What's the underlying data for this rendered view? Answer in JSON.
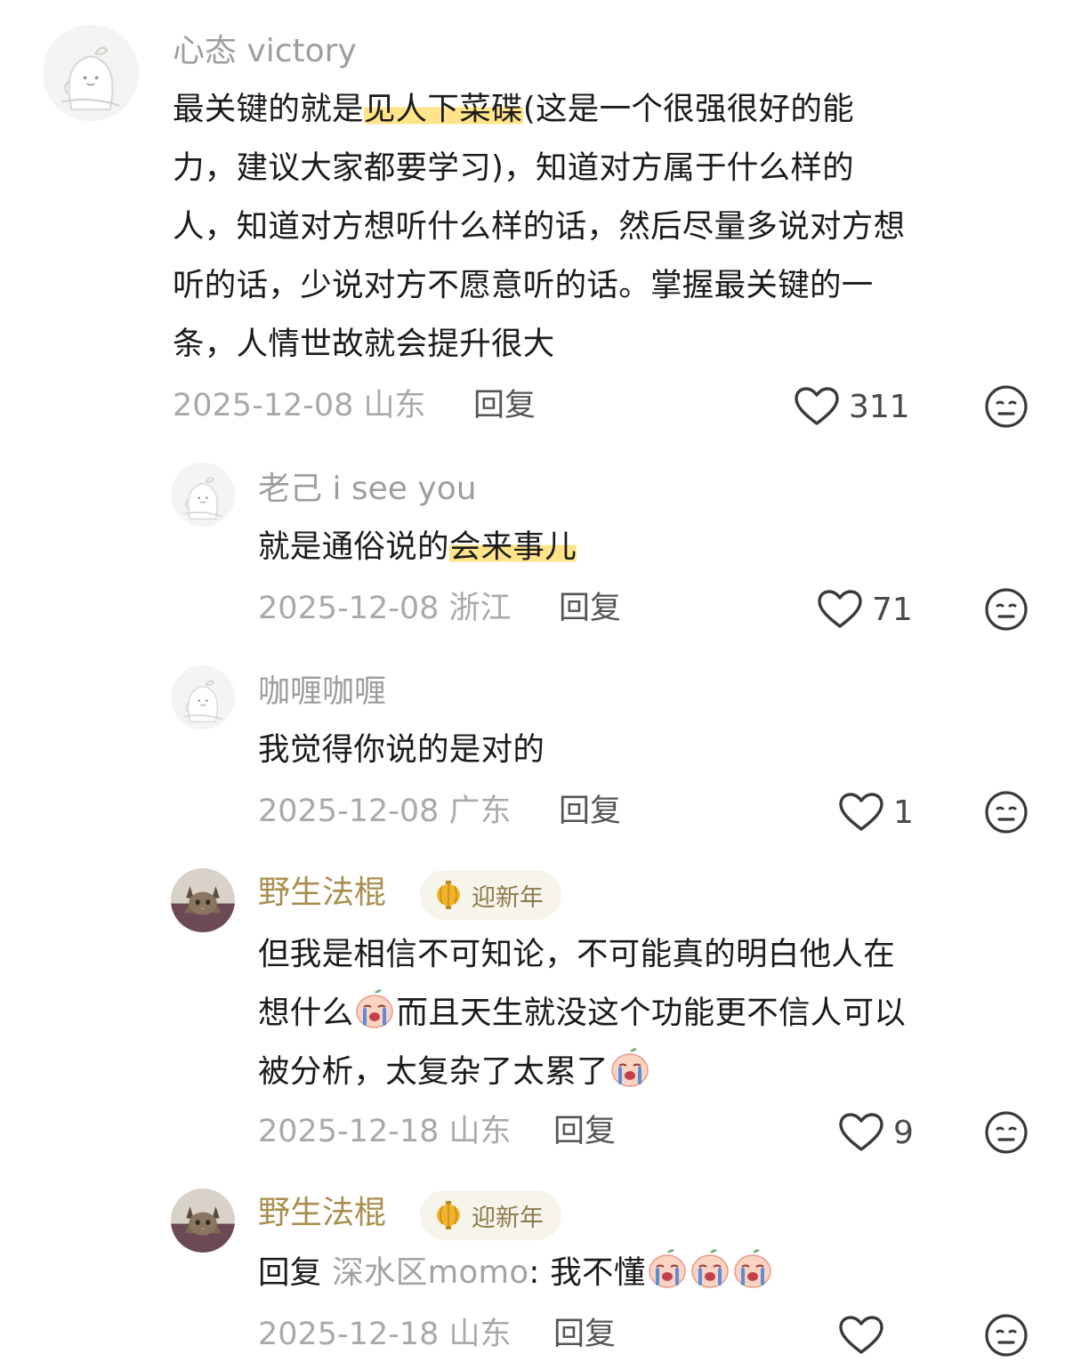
{
  "comments": [
    {
      "username": "心态 victory",
      "text_lines": [
        "最关键的就是",
        "见人下菜碟",
        "(这是一个很强很好的能",
        "力，建议大家都要学习)，知道对方属于什么样的",
        "人，知道对方想听什么样的话，然后尽量多说对方想",
        "听的话，少说对方不愿意听的话。掌握最关键的一",
        "条，人情世故就会提升很大"
      ],
      "date": "2025-12-08",
      "location": "山东",
      "reply_label": "回复",
      "likes": "311"
    },
    {
      "username": "老己 i see you",
      "text_plain": "就是通俗说的",
      "text_highlight": "会来事儿",
      "date": "2025-12-08",
      "location": "浙江",
      "reply_label": "回复",
      "likes": "71"
    },
    {
      "username": "咖喱咖喱",
      "text": "我觉得你说的是对的",
      "date": "2025-12-08",
      "location": "广东",
      "reply_label": "回复",
      "likes": "1"
    },
    {
      "username": "野生法棍",
      "badge": "迎新年",
      "line1": "但我是相信不可知论，不可能真的明白他人在",
      "line2a": "想什么",
      "line2b": "而且天生就没这个功能更不信人可以",
      "line3": "被分析，太复杂了太累了",
      "date": "2025-12-18",
      "location": "山东",
      "reply_label": "回复",
      "likes": "9"
    },
    {
      "username": "野生法棍",
      "badge": "迎新年",
      "reply_prefix": "回复",
      "mention": "深水区momo",
      "text": ": 我不懂",
      "date": "2025-12-18",
      "location": "山东",
      "reply_label": "回复",
      "likes": ""
    }
  ],
  "icons": {
    "like": "heart-outline-icon",
    "dislike": "meh-face-icon",
    "crying": "crying-emoji",
    "lantern": "lantern-icon"
  },
  "colors": {
    "highlight": "#ffe48a",
    "username": "#9e9e9e",
    "username_badge_user": "#a88f4e",
    "meta": "#a9a9a9"
  }
}
